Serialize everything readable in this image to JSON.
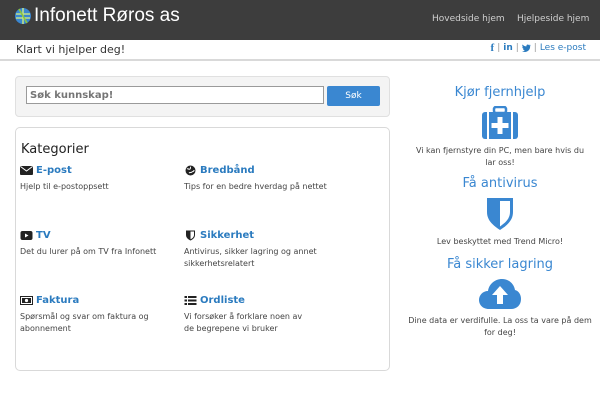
{
  "header": {
    "brand": "Infonett Røros as",
    "nav": {
      "home": "Hovedside hjem",
      "help": "Hjelpeside hjem"
    }
  },
  "subheader": {
    "tagline": "Klart vi hjelper deg!",
    "social": {
      "facebook": "f",
      "linkedin": "in",
      "twitter": "twitter-icon",
      "email": "Les e-post"
    }
  },
  "search": {
    "placeholder": "Søk kunnskap!",
    "button": "Søk"
  },
  "categories": {
    "title": "Kategorier",
    "items": [
      {
        "icon": "envelope-icon",
        "name": "E-post",
        "desc": "Hjelp til e-postoppsett"
      },
      {
        "icon": "globe-icon",
        "name": "Bredbånd",
        "desc": "Tips for en bedre hverdag på nettet"
      },
      {
        "icon": "play-icon",
        "name": "TV",
        "desc": "Det du lurer på om TV fra Infonett"
      },
      {
        "icon": "shield-icon",
        "name": "Sikkerhet",
        "desc": "Antivirus, sikker lagring og annet sikkerhetsrelatert"
      },
      {
        "icon": "money-icon",
        "name": "Faktura",
        "desc": "Spørsmål og svar om faktura og abonnement"
      },
      {
        "icon": "list-icon",
        "name": "Ordliste",
        "desc": "Vi forsøker å forklare noen av de begrepene vi bruker"
      }
    ]
  },
  "side": {
    "remote": {
      "title": "Kjør fjernhjelp",
      "icon": "medkit-icon",
      "desc": "Vi kan fjernstyre din PC, men bare hvis du lar oss!"
    },
    "antivirus": {
      "title": "Få antivirus",
      "icon": "shield-icon",
      "desc": "Lev beskyttet med Trend Micro!"
    },
    "storage": {
      "title": "Få sikker lagring",
      "icon": "cloud-upload-icon",
      "desc": "Dine data er verdifulle. La oss ta vare på dem for deg!"
    }
  },
  "colors": {
    "accent": "#3a87d1",
    "topbar": "#3d3d3d"
  }
}
